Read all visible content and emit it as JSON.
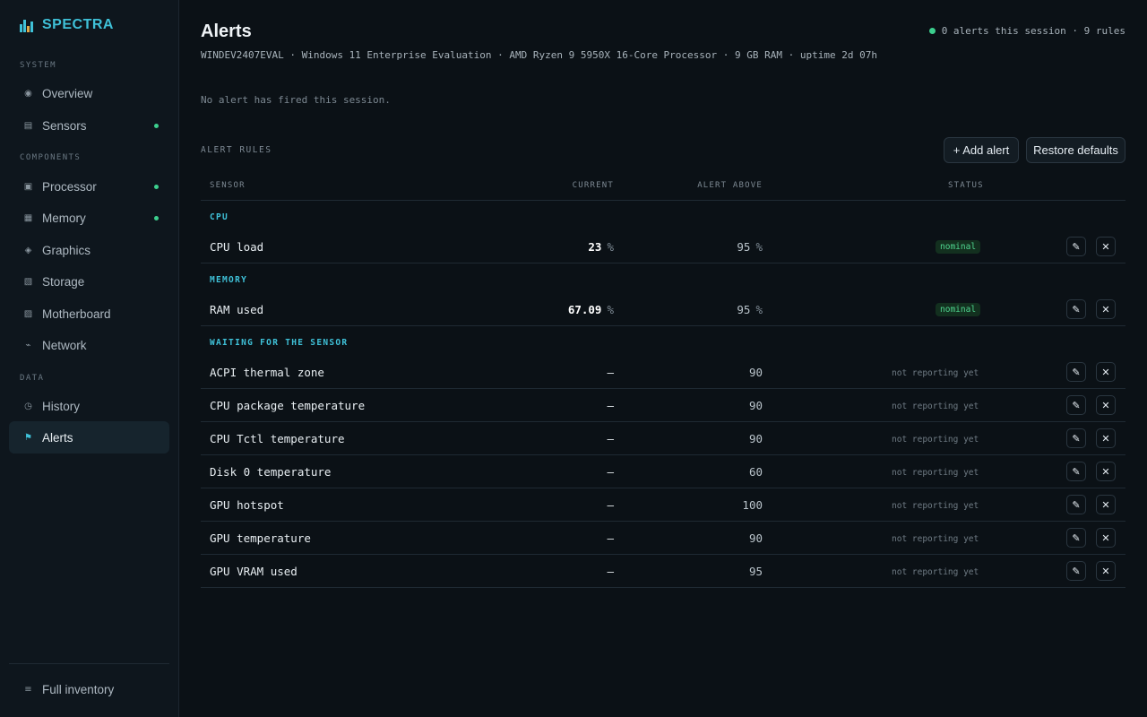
{
  "app": {
    "name": "SPECTRA",
    "accent": "#3fc1d8",
    "ok_color": "#3ccf8e"
  },
  "sidebar": {
    "sections": [
      {
        "label": "SYSTEM"
      },
      {
        "label": "COMPONENTS"
      },
      {
        "label": "DATA"
      }
    ],
    "items": [
      {
        "label": "Overview",
        "icon": "overview-icon",
        "glyph": "◉",
        "status_dot": false
      },
      {
        "label": "Sensors",
        "icon": "sensors-icon",
        "glyph": "▤",
        "status_dot": true
      },
      {
        "label": "Processor",
        "icon": "processor-icon",
        "glyph": "▣",
        "status_dot": true
      },
      {
        "label": "Memory",
        "icon": "memory-icon",
        "glyph": "▦",
        "status_dot": true
      },
      {
        "label": "Graphics",
        "icon": "graphics-icon",
        "glyph": "◈",
        "status_dot": false
      },
      {
        "label": "Storage",
        "icon": "storage-icon",
        "glyph": "▧",
        "status_dot": false
      },
      {
        "label": "Motherboard",
        "icon": "motherboard-icon",
        "glyph": "▨",
        "status_dot": false
      },
      {
        "label": "Network",
        "icon": "network-icon",
        "glyph": "⌁",
        "status_dot": false
      },
      {
        "label": "History",
        "icon": "history-icon",
        "glyph": "◷",
        "status_dot": false
      },
      {
        "label": "Alerts",
        "icon": "flag-icon",
        "glyph": "⚑",
        "status_dot": false,
        "active": true
      }
    ],
    "footer": {
      "label": "Full inventory",
      "icon": "list-icon",
      "glyph": "≡"
    }
  },
  "header": {
    "title": "Alerts",
    "subtitle": "WINDEV2407EVAL · Windows 11 Enterprise Evaluation · AMD Ryzen 9 5950X 16-Core Processor · 9 GB RAM · uptime 2d 07h",
    "session_status": "0 alerts this session · 9 rules"
  },
  "empty_state": "No alert has fired this session.",
  "rules": {
    "label": "ALERT RULES",
    "add_button": "+ Add alert",
    "restore_button": "Restore defaults",
    "columns": {
      "sensor": "SENSOR",
      "current": "CURRENT",
      "alert_above": "ALERT ABOVE",
      "status": "STATUS"
    },
    "groups": [
      {
        "label": "CPU",
        "rows": [
          {
            "name": "CPU load",
            "current": "23",
            "current_unit": "%",
            "threshold": "95",
            "threshold_unit": "%",
            "status": "nominal"
          }
        ]
      },
      {
        "label": "MEMORY",
        "rows": [
          {
            "name": "RAM used",
            "current": "67.09",
            "current_unit": "%",
            "threshold": "95",
            "threshold_unit": "%",
            "status": "nominal"
          }
        ]
      },
      {
        "label": "WAITING FOR THE SENSOR",
        "rows": [
          {
            "name": "ACPI thermal zone",
            "current": "–",
            "threshold": "90",
            "status": "not reporting yet"
          },
          {
            "name": "CPU package temperature",
            "current": "–",
            "threshold": "90",
            "status": "not reporting yet"
          },
          {
            "name": "CPU Tctl temperature",
            "current": "–",
            "threshold": "90",
            "status": "not reporting yet"
          },
          {
            "name": "Disk 0 temperature",
            "current": "–",
            "threshold": "60",
            "status": "not reporting yet"
          },
          {
            "name": "GPU hotspot",
            "current": "–",
            "threshold": "100",
            "status": "not reporting yet"
          },
          {
            "name": "GPU temperature",
            "current": "–",
            "threshold": "90",
            "status": "not reporting yet"
          },
          {
            "name": "GPU VRAM used",
            "current": "–",
            "threshold": "95",
            "status": "not reporting yet"
          }
        ]
      }
    ],
    "row_actions": {
      "edit_glyph": "✎",
      "delete_glyph": "✕"
    }
  }
}
